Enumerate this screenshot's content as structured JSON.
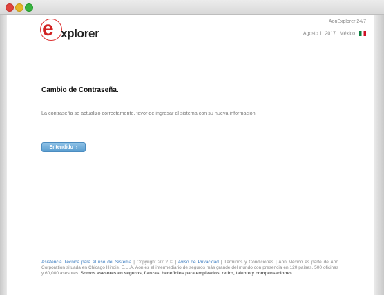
{
  "header": {
    "brand": "AonExplorer 24/7",
    "date": "Agosto 1, 2017",
    "country": "México"
  },
  "logo": {
    "initial": "e",
    "rest": "xplorer"
  },
  "main": {
    "title": "Cambio de Contraseña.",
    "message": "La contraseña se actualizó correctamente, favor de ingresar al sistema con su nueva información.",
    "button_label": "Entendido",
    "button_arrow": "›"
  },
  "footer": {
    "support_link": "Asistencia Técnica para el uso del Sistema",
    "copyright": " | Copyright 2012 © | ",
    "privacy_link": "Aviso de Privacidad",
    "terms_text": " | Términos y Condiciones | Aon México es parte de Aon Corporation situada en Chicago Illinois, E.U.A. Aon es el intermediario de seguros más grande del mundo con presencia en 120 países, 500 oficinas y 60,000 asesores. ",
    "slogan": "Somos asesores en seguros, fianzas, beneficios para empleados, retiro, talento y compensaciones."
  },
  "colors": {
    "button": "#5a9dd0",
    "link": "#3a7bbf",
    "logo_red": "#d12222"
  }
}
